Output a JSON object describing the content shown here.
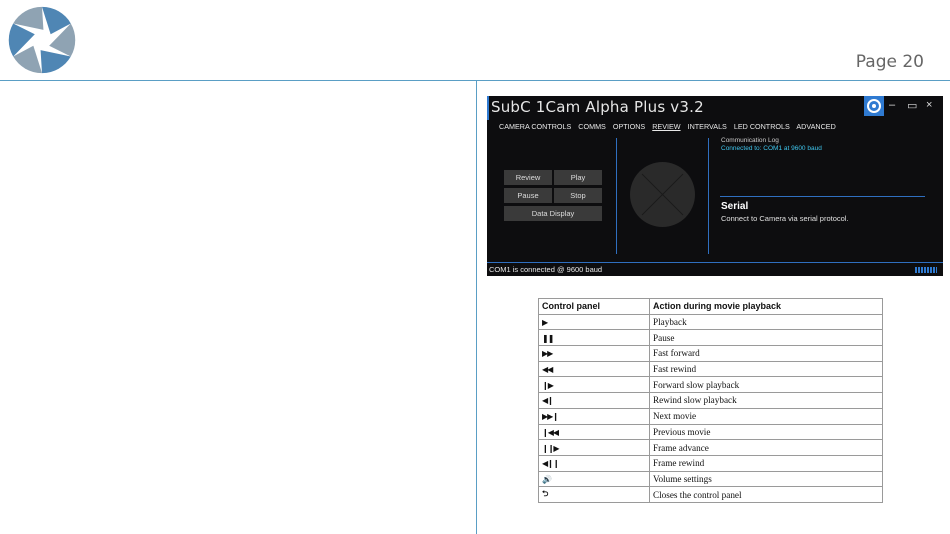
{
  "page": {
    "number_label": "Page 20"
  },
  "colors": {
    "accent": "#2f7ad1",
    "rule": "#5a9ec5",
    "app_bg": "#0d0d0f",
    "highlight_text": "#3fc6ee"
  },
  "app": {
    "title": "SubC 1Cam Alpha Plus v3.2",
    "window_controls": [
      "–",
      "▭",
      "×"
    ],
    "menu": [
      "CAMERA CONTROLS",
      "COMMS",
      "OPTIONS",
      "REVIEW",
      "INTERVALS",
      "LED CONTROLS",
      "ADVANCED"
    ],
    "active_menu": "REVIEW",
    "buttons": {
      "review": "Review",
      "play": "Play",
      "pause": "Pause",
      "stop": "Stop",
      "data_display": "Data Display"
    },
    "log": {
      "title": "Communication Log",
      "line": "Connected to: COM1 at 9600 baud"
    },
    "serial": {
      "title": "Serial",
      "description": "Connect to Camera via serial protocol."
    },
    "status": "COM1 is connected @ 9600 baud"
  },
  "table": {
    "headers": [
      "Control panel",
      "Action during movie playback"
    ],
    "rows": [
      {
        "icon": "play-icon",
        "symbol": "▶",
        "action": "Playback"
      },
      {
        "icon": "pause-icon",
        "symbol": "❚❚",
        "action": "Pause"
      },
      {
        "icon": "fast-forward-icon",
        "symbol": "▶▶",
        "action": "Fast forward"
      },
      {
        "icon": "fast-rewind-icon",
        "symbol": "◀◀",
        "action": "Fast rewind"
      },
      {
        "icon": "forward-slow-icon",
        "symbol": "❙▶",
        "action": "Forward slow playback"
      },
      {
        "icon": "rewind-slow-icon",
        "symbol": "◀❙",
        "action": "Rewind slow playback"
      },
      {
        "icon": "next-movie-icon",
        "symbol": "▶▶❙",
        "action": "Next movie"
      },
      {
        "icon": "previous-movie-icon",
        "symbol": "❙◀◀",
        "action": "Previous movie"
      },
      {
        "icon": "frame-advance-icon",
        "symbol": "❙❙▶",
        "action": "Frame advance"
      },
      {
        "icon": "frame-rewind-icon",
        "symbol": "◀❙❙",
        "action": "Frame rewind"
      },
      {
        "icon": "volume-icon",
        "symbol": "🔊",
        "action": "Volume settings"
      },
      {
        "icon": "return-icon",
        "symbol": "⮌",
        "action": "Closes the control panel"
      }
    ]
  }
}
